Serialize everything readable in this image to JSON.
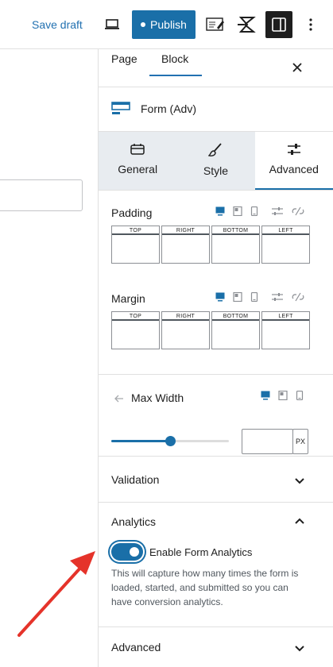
{
  "toolbar": {
    "save_draft": "Save draft",
    "publish": "Publish",
    "icons": [
      "desktop-preview-icon",
      "site-editor-icon",
      "lightning-icon",
      "sidebar-toggle-icon",
      "more-options-icon"
    ]
  },
  "sidebar": {
    "tabs": {
      "page": "Page",
      "block": "Block"
    },
    "block_name": "Form (Adv)",
    "subtabs": {
      "general": "General",
      "style": "Style",
      "advanced": "Advanced"
    },
    "padding": {
      "label": "Padding",
      "boxes": [
        "TOP",
        "RIGHT",
        "BOTTOM",
        "LEFT"
      ]
    },
    "margin": {
      "label": "Margin",
      "boxes": [
        "TOP",
        "RIGHT",
        "BOTTOM",
        "LEFT"
      ]
    },
    "max_width": {
      "label": "Max Width",
      "value": "",
      "unit": "PX",
      "slider_fraction": 0.5
    },
    "panels": {
      "validation": "Validation",
      "analytics": "Analytics",
      "advanced": "Advanced"
    },
    "analytics": {
      "toggle_label": "Enable Form Analytics",
      "enabled": true,
      "help": "This will capture how many times the form is loaded, started, and submitted so you can have conversion analytics."
    }
  },
  "colors": {
    "accent": "#1a6fa8",
    "link": "#2271b1",
    "annotation_arrow": "#e5332a"
  }
}
